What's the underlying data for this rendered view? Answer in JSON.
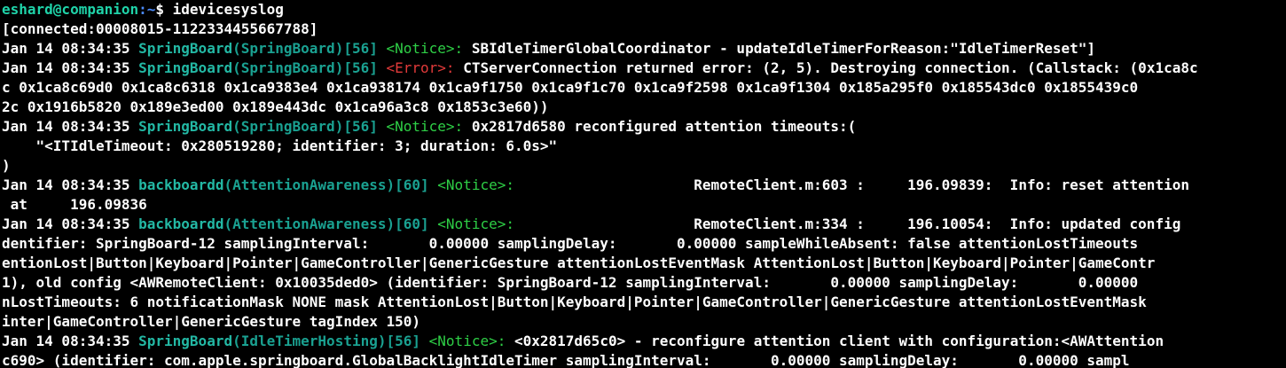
{
  "prompt": {
    "user_host": "eshard@companion",
    "path": ":~",
    "symbol": "$ ",
    "command": "idevicesyslog"
  },
  "lines": [
    {
      "segments": [
        {
          "text": "[connected:00008015-1122334455667788]",
          "cls": "c-plain"
        }
      ]
    },
    {
      "segments": [
        {
          "text": "Jan 14 08:34:35 ",
          "cls": "c-plain"
        },
        {
          "text": "SpringBoard",
          "cls": "c-proc"
        },
        {
          "text": "(SpringBoard)[56] ",
          "cls": "c-procname"
        },
        {
          "text": "<Notice>: ",
          "cls": "c-notice"
        },
        {
          "text": "SBIdleTimerGlobalCoordinator - updateIdleTimerForReason:\"IdleTimerReset\"]",
          "cls": "c-plain"
        }
      ]
    },
    {
      "segments": [
        {
          "text": "Jan 14 08:34:35 ",
          "cls": "c-plain"
        },
        {
          "text": "SpringBoard",
          "cls": "c-proc"
        },
        {
          "text": "(SpringBoard)[56] ",
          "cls": "c-procname"
        },
        {
          "text": "<Error>: ",
          "cls": "c-error"
        },
        {
          "text": "CTServerConnection returned error: (2, 5). Destroying connection. (Callstack: (0x1ca8c",
          "cls": "c-plain"
        }
      ]
    },
    {
      "segments": [
        {
          "text": "c 0x1ca8c69d0 0x1ca8c6318 0x1ca9383e4 0x1ca938174 0x1ca9f1750 0x1ca9f1c70 0x1ca9f2598 0x1ca9f1304 0x185a295f0 0x185543dc0 0x1855439c0",
          "cls": "c-plain"
        }
      ]
    },
    {
      "segments": [
        {
          "text": "2c 0x1916b5820 0x189e3ed00 0x189e443dc 0x1ca96a3c8 0x1853c3e60))",
          "cls": "c-plain"
        }
      ]
    },
    {
      "segments": [
        {
          "text": "Jan 14 08:34:35 ",
          "cls": "c-plain"
        },
        {
          "text": "SpringBoard",
          "cls": "c-proc"
        },
        {
          "text": "(SpringBoard)[56] ",
          "cls": "c-procname"
        },
        {
          "text": "<Notice>: ",
          "cls": "c-notice"
        },
        {
          "text": "0x2817d6580 reconfigured attention timeouts:(",
          "cls": "c-plain"
        }
      ]
    },
    {
      "segments": [
        {
          "text": "    \"<ITIdleTimeout: 0x280519280; identifier: 3; duration: 6.0s>\"",
          "cls": "c-plain"
        }
      ]
    },
    {
      "segments": [
        {
          "text": ")",
          "cls": "c-plain"
        }
      ]
    },
    {
      "segments": [
        {
          "text": "Jan 14 08:34:35 ",
          "cls": "c-plain"
        },
        {
          "text": "backboardd",
          "cls": "c-proc"
        },
        {
          "text": "(AttentionAwareness)[60] ",
          "cls": "c-procname"
        },
        {
          "text": "<Notice>: ",
          "cls": "c-notice"
        },
        {
          "text": "                    RemoteClient.m:603 :     196.09839:  Info: reset attention",
          "cls": "c-plain"
        }
      ]
    },
    {
      "segments": [
        {
          "text": " at     196.09836",
          "cls": "c-plain"
        }
      ]
    },
    {
      "segments": [
        {
          "text": "Jan 14 08:34:35 ",
          "cls": "c-plain"
        },
        {
          "text": "backboardd",
          "cls": "c-proc"
        },
        {
          "text": "(AttentionAwareness)[60] ",
          "cls": "c-procname"
        },
        {
          "text": "<Notice>: ",
          "cls": "c-notice"
        },
        {
          "text": "                    RemoteClient.m:334 :     196.10054:  Info: updated config",
          "cls": "c-plain"
        }
      ]
    },
    {
      "segments": [
        {
          "text": "dentifier: SpringBoard-12 samplingInterval:       0.00000 samplingDelay:       0.00000 sampleWhileAbsent: false attentionLostTimeouts",
          "cls": "c-plain"
        }
      ]
    },
    {
      "segments": [
        {
          "text": "entionLost|Button|Keyboard|Pointer|GameController|GenericGesture attentionLostEventMask AttentionLost|Button|Keyboard|Pointer|GameContr",
          "cls": "c-plain"
        }
      ]
    },
    {
      "segments": [
        {
          "text": "1), old config <AWRemoteClient: 0x10035ded0> (identifier: SpringBoard-12 samplingInterval:       0.00000 samplingDelay:       0.00000",
          "cls": "c-plain"
        }
      ]
    },
    {
      "segments": [
        {
          "text": "nLostTimeouts: 6 notificationMask NONE mask AttentionLost|Button|Keyboard|Pointer|GameController|GenericGesture attentionLostEventMask",
          "cls": "c-plain"
        }
      ]
    },
    {
      "segments": [
        {
          "text": "inter|GameController|GenericGesture tagIndex 150)",
          "cls": "c-plain"
        }
      ]
    },
    {
      "segments": [
        {
          "text": "Jan 14 08:34:35 ",
          "cls": "c-plain"
        },
        {
          "text": "SpringBoard",
          "cls": "c-proc"
        },
        {
          "text": "(IdleTimerHosting)[56] ",
          "cls": "c-procname"
        },
        {
          "text": "<Notice>: ",
          "cls": "c-notice"
        },
        {
          "text": "<0x2817d65c0> - reconfigure attention client with configuration:<AWAttention",
          "cls": "c-plain"
        }
      ]
    },
    {
      "segments": [
        {
          "text": "c690> (identifier: com.apple.springboard.GlobalBacklightIdleTimer samplingInterval:       0.00000 samplingDelay:       0.00000 sampl",
          "cls": "c-plain"
        }
      ]
    }
  ]
}
